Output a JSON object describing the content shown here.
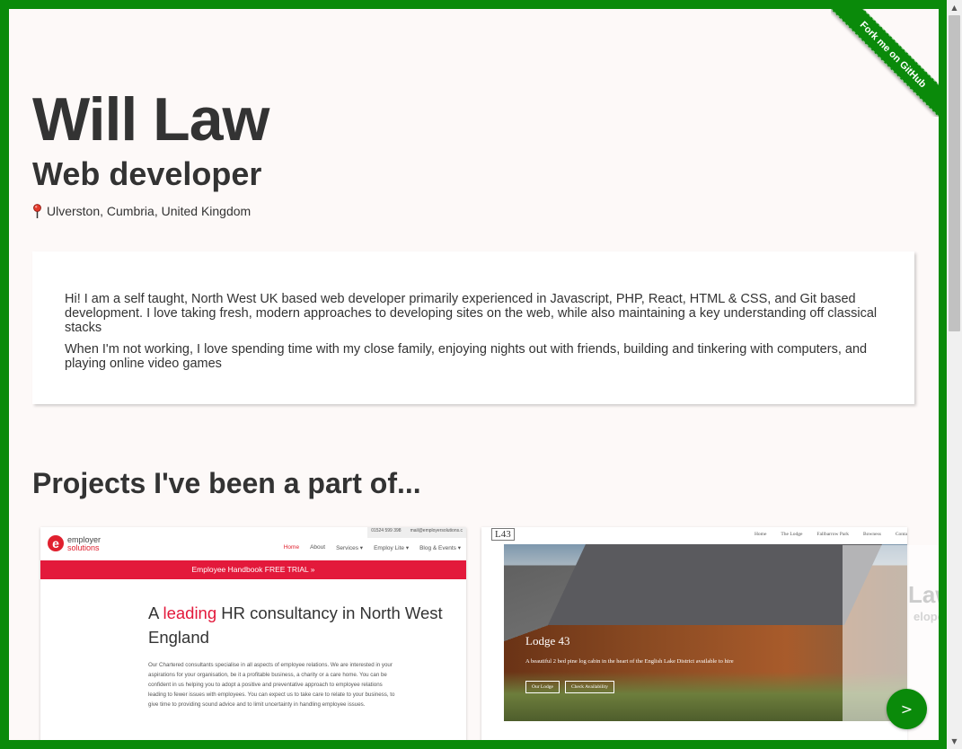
{
  "ribbon": {
    "label": "Fork me on GitHub"
  },
  "header": {
    "name": "Will Law",
    "role": "Web developer",
    "location_icon": "map-pin-icon",
    "location": "Ulverston, Cumbria, United Kingdom"
  },
  "about": {
    "paragraphs": [
      "Hi! I am a self taught, North West UK based web developer primarily experienced in Javascript, PHP, React, HTML & CSS, and Git based development. I love taking fresh, modern approaches to developing sites on the web, while also maintaining a key understanding off classical stacks",
      "When I'm not working, I love spending time with my close family, enjoying nights out with friends, building and tinkering with computers, and playing online video games"
    ]
  },
  "projects": {
    "title": "Projects I've been a part of...",
    "employer_solutions": {
      "top_phone": "01524 599 398",
      "top_email": "mail@employersolutions.c",
      "logo_mark": "e",
      "logo_line1": "employer",
      "logo_line2": "solutions",
      "nav": [
        "Home",
        "About",
        "Services ▾",
        "Employ Lite ▾",
        "Blog & Events ▾"
      ],
      "banner": "Employee Handbook FREE TRIAL »",
      "headline_pre": "A ",
      "headline_highlight": "leading",
      "headline_post": " HR consultancy in North West England",
      "body": "Our Chartered consultants specialise in all aspects of employee relations. We are interested in your aspirations for your organisation, be it a profitable business, a charity or a care home. You can be confident in us helping you to adopt a positive and preventative approach to employee relations leading to fewer issues with employees. You can expect us to take care to relate to your business, to give time to providing sound advice and to limit uncertainty in handling employee issues."
    },
    "lodge43": {
      "logo": "L43",
      "nav": [
        "Home",
        "The Lodge",
        "Fallbarrow Park",
        "Bowness",
        "Conta"
      ],
      "title": "Lodge 43",
      "subtitle": "A beautiful 2 bed pine log cabin in the heart of the English Lake District available to hire",
      "btn_lodge": "Our Lodge",
      "btn_avail": "Check Availability"
    }
  },
  "ghost": {
    "name": "Law",
    "role": "eloper"
  },
  "nav": {
    "next_label": ">"
  },
  "scrollbar": {
    "up": "▲",
    "down": "▼"
  },
  "colors": {
    "frame": "#0a8a0a",
    "page_bg": "#fdf9f8",
    "accent_red": "#e3193b"
  }
}
